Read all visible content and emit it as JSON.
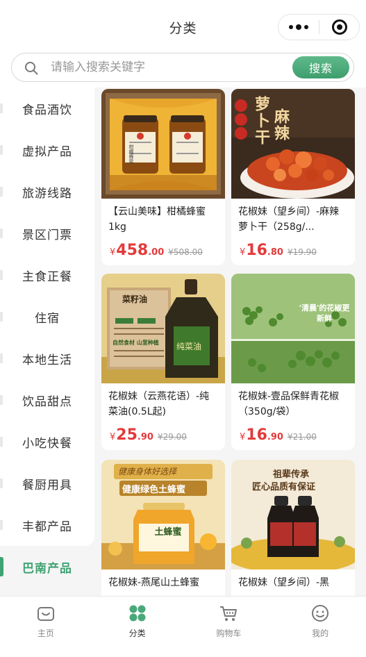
{
  "header": {
    "title": "分类"
  },
  "search": {
    "placeholder": "请输入搜索关键字",
    "button": "搜索"
  },
  "sidebar": {
    "items": [
      {
        "label": "食品酒饮"
      },
      {
        "label": "虚拟产品"
      },
      {
        "label": "旅游线路"
      },
      {
        "label": "景区门票"
      },
      {
        "label": "主食正餐"
      },
      {
        "label": "住宿"
      },
      {
        "label": "本地生活"
      },
      {
        "label": "饮品甜点"
      },
      {
        "label": "小吃快餐"
      },
      {
        "label": "餐厨用具"
      },
      {
        "label": "丰都产品"
      },
      {
        "label": "巴南产品"
      }
    ],
    "active_index": 11
  },
  "products": [
    {
      "name": "【云山美味】柑橘蜂蜜1kg",
      "price_symbol": "¥",
      "price_int": "458",
      "price_dec": ".00",
      "orig": "¥508.00",
      "image": {
        "jar_label": "柑橘蜂蜜"
      }
    },
    {
      "name": "花椒妹（望乡间）-麻辣萝卜干（258g/...",
      "price_symbol": "¥",
      "price_int": "16",
      "price_dec": ".80",
      "orig": "¥19.90",
      "image": {
        "headline_a": "萝卜干",
        "headline_b": "麻辣"
      }
    },
    {
      "name": "花椒妹（云燕花语）-纯菜油(0.5L起)",
      "price_symbol": "¥",
      "price_int": "25",
      "price_dec": ".90",
      "orig": "¥29.00",
      "image": {
        "sign": "菜籽油",
        "bottle_label": "纯菜油",
        "slogan": "自然食材 山里种植"
      }
    },
    {
      "name": "花椒妹-壹品保鲜青花椒（350g/袋）",
      "price_symbol": "¥",
      "price_int": "16",
      "price_dec": ".90",
      "orig": "¥21.00",
      "image": {
        "quote": "'清晨'的花椒更新鲜"
      }
    },
    {
      "name": "花椒妹-燕尾山土蜂蜜",
      "price_symbol": "¥",
      "price_int": "",
      "price_dec": "",
      "orig": "",
      "image": {
        "top": "健康身体好选择",
        "headline": "健康绿色土蜂蜜",
        "jar_label": "土蜂蜜"
      }
    },
    {
      "name": "花椒妹（望乡间）-黑",
      "price_symbol": "¥",
      "price_int": "",
      "price_dec": "",
      "orig": "",
      "image": {
        "top": "祖辈传承",
        "headline": "匠心品质有保证"
      }
    }
  ],
  "tabbar": {
    "tabs": [
      {
        "label": "主页",
        "icon": "home-icon"
      },
      {
        "label": "分类",
        "icon": "category-icon"
      },
      {
        "label": "购物车",
        "icon": "cart-icon"
      },
      {
        "label": "我的",
        "icon": "profile-icon"
      }
    ],
    "active_index": 1
  },
  "colors": {
    "accent": "#3ea272",
    "price": "#e23b3b"
  }
}
